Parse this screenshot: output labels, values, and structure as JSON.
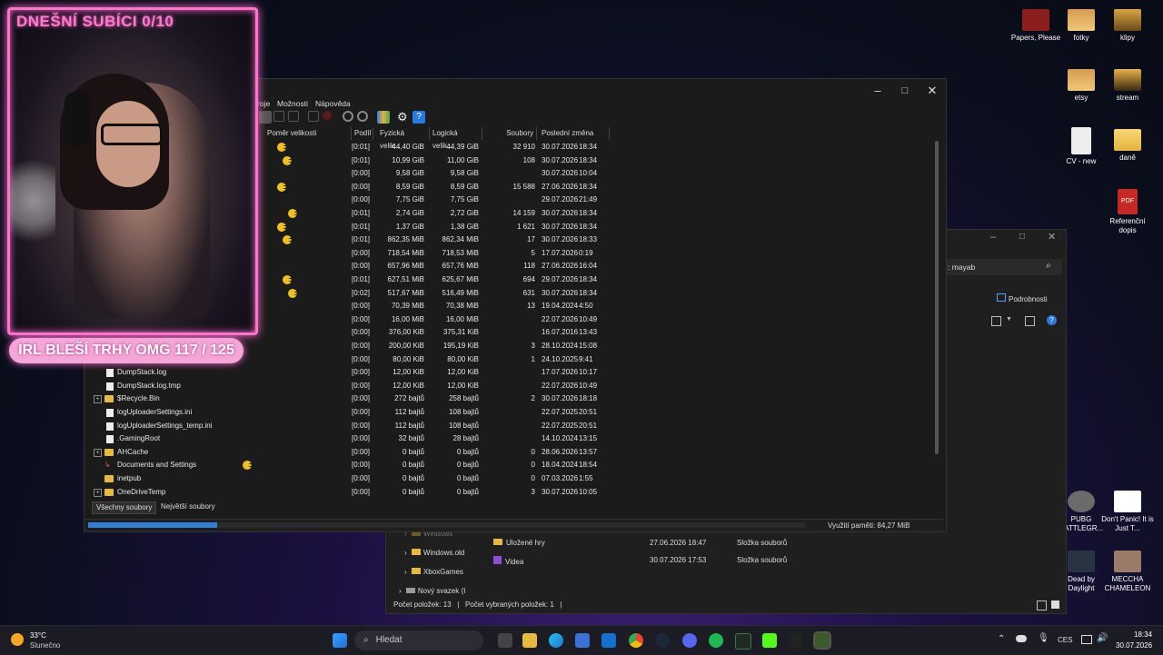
{
  "overlay": {
    "subs_counter": "DNEŠNÍ SUBÍCI 0/10",
    "goal_text": "IRL BLEŠÍ TRHY OMG  117 / 125"
  },
  "desktop": {
    "icons": [
      {
        "label": "Papers, Please",
        "icon": "papers-please-icon"
      },
      {
        "label": "fotky",
        "icon": "folder-icon"
      },
      {
        "label": "klipy",
        "icon": "folder-icon"
      },
      {
        "label": "etsy",
        "icon": "folder-icon"
      },
      {
        "label": "stream",
        "icon": "folder-icon"
      },
      {
        "label": "CV - new",
        "icon": "document-icon"
      },
      {
        "label": "daně",
        "icon": "folder-icon"
      },
      {
        "label": "Referenční dopis",
        "icon": "pdf-icon"
      },
      {
        "label": "PUBG BATTLEGR...",
        "icon": "pubg-icon"
      },
      {
        "label": "Don't Panic! It is Just T...",
        "icon": "dont-panic-icon"
      },
      {
        "label": "Dead by Daylight",
        "icon": "dbd-icon"
      },
      {
        "label": "MECCHA CHAMELEON",
        "icon": "meccha-icon"
      }
    ]
  },
  "main_window": {
    "menu": [
      "roje",
      "Možnosti",
      "Nápověda"
    ],
    "columns": [
      "Poměr velikosti",
      "Podíl",
      "Fyzická velik...",
      "Logická velik...",
      "Soubory",
      "Poslední změna"
    ],
    "rows": [
      {
        "name": "",
        "share": "[0:01]",
        "phys": "44,40 GiB",
        "logic": "44,39 GiB",
        "files": "32 910",
        "date": "30.07.2026",
        "time": "18:34",
        "pac": true
      },
      {
        "name": "",
        "share": "[0:01]",
        "phys": "10,99 GiB",
        "logic": "11,00 GiB",
        "files": "108",
        "date": "30.07.2026",
        "time": "18:34",
        "pac": true
      },
      {
        "name": "",
        "share": "[0:00]",
        "phys": "9,58 GiB",
        "logic": "9,58 GiB",
        "files": "",
        "date": "30.07.2026",
        "time": "10:04",
        "pac": false
      },
      {
        "name": "",
        "share": "[0:00]",
        "phys": "8,59 GiB",
        "logic": "8,59 GiB",
        "files": "15 588",
        "date": "27.06.2026",
        "time": "18:34",
        "pac": true
      },
      {
        "name": "",
        "share": "[0:00]",
        "phys": "7,75 GiB",
        "logic": "7,75 GiB",
        "files": "",
        "date": "29.07.2026",
        "time": "21:49",
        "pac": false
      },
      {
        "name": "",
        "share": "[0:01]",
        "phys": "2,74 GiB",
        "logic": "2,72 GiB",
        "files": "14 159",
        "date": "30.07.2026",
        "time": "18:34",
        "pac": true
      },
      {
        "name": "",
        "share": "[0:01]",
        "phys": "1,37 GiB",
        "logic": "1,38 GiB",
        "files": "1 621",
        "date": "30.07.2026",
        "time": "18:34",
        "pac": true
      },
      {
        "name": "",
        "share": "[0:01]",
        "phys": "862,35 MiB",
        "logic": "862,34 MiB",
        "files": "17",
        "date": "30.07.2026",
        "time": "18:33",
        "pac": true
      },
      {
        "name": "",
        "share": "[0:00]",
        "phys": "718,54 MiB",
        "logic": "718,53 MiB",
        "files": "5",
        "date": "17.07.2026",
        "time": "0:19",
        "pac": false
      },
      {
        "name": "",
        "share": "[0:00]",
        "phys": "657,96 MiB",
        "logic": "657,76 MiB",
        "files": "118",
        "date": "27.06.2026",
        "time": "16:04",
        "pac": false
      },
      {
        "name": "",
        "share": "[0:01]",
        "phys": "627,51 MiB",
        "logic": "625,67 MiB",
        "files": "694",
        "date": "29.07.2026",
        "time": "18:34",
        "pac": true
      },
      {
        "name": "",
        "share": "[0:02]",
        "phys": "517,67 MiB",
        "logic": "516,49 MiB",
        "files": "631",
        "date": "30.07.2026",
        "time": "18:34",
        "pac": true
      },
      {
        "name": "",
        "share": "[0:00]",
        "phys": "70,39 MiB",
        "logic": "70,38 MiB",
        "files": "13",
        "date": "19.04.2024",
        "time": "4:50",
        "pac": false
      },
      {
        "name": "",
        "share": "[0:00]",
        "phys": "16,00 MiB",
        "logic": "16,00 MiB",
        "files": "",
        "date": "22.07.2026",
        "time": "10:49",
        "pac": false
      },
      {
        "name": "",
        "share": "[0:00]",
        "phys": "376,00 KiB",
        "logic": "375,31 KiB",
        "files": "",
        "date": "16.07.2016",
        "time": "13:43",
        "pac": false
      },
      {
        "name": "",
        "share": "[0:00]",
        "phys": "200,00 KiB",
        "logic": "195,19 KiB",
        "files": "3",
        "date": "28.10.2024",
        "time": "15:08",
        "pac": false
      },
      {
        "name": "",
        "share": "[0:00]",
        "phys": "80,00 KiB",
        "logic": "80,00 KiB",
        "files": "1",
        "date": "24.10.2025",
        "time": "9:41",
        "pac": false
      },
      {
        "name": "DumpStack.log",
        "share": "[0:00]",
        "phys": "12,00 KiB",
        "logic": "12,00 KiB",
        "files": "",
        "date": "17.07.2026",
        "time": "10:17",
        "pac": false,
        "kind": "file"
      },
      {
        "name": "DumpStack.log.tmp",
        "share": "[0:00]",
        "phys": "12,00 KiB",
        "logic": "12,00 KiB",
        "files": "",
        "date": "22.07.2026",
        "time": "10:49",
        "pac": false,
        "kind": "file"
      },
      {
        "name": "$Recycle.Bin",
        "share": "[0:00]",
        "phys": "272 bajtů",
        "logic": "258 bajtů",
        "files": "2",
        "date": "30.07.2026",
        "time": "18:18",
        "pac": false,
        "kind": "folder",
        "expand": true
      },
      {
        "name": "logUploaderSettings.ini",
        "share": "[0:00]",
        "phys": "112 bajtů",
        "logic": "108 bajtů",
        "files": "",
        "date": "22.07.2025",
        "time": "20:51",
        "pac": false,
        "kind": "file"
      },
      {
        "name": "logUploaderSettings_temp.ini",
        "share": "[0:00]",
        "phys": "112 bajtů",
        "logic": "108 bajtů",
        "files": "",
        "date": "22.07.2025",
        "time": "20:51",
        "pac": false,
        "kind": "file"
      },
      {
        "name": ".GamingRoot",
        "share": "[0:00]",
        "phys": "32 bajtů",
        "logic": "28 bajtů",
        "files": "",
        "date": "14.10.2024",
        "time": "13:15",
        "pac": false,
        "kind": "file"
      },
      {
        "name": "AHCache",
        "share": "[0:00]",
        "phys": "0 bajtů",
        "logic": "0 bajtů",
        "files": "0",
        "date": "28.06.2026",
        "time": "13:57",
        "pac": false,
        "kind": "folder",
        "expand": true
      },
      {
        "name": "Documents and Settings",
        "share": "[0:00]",
        "phys": "0 bajtů",
        "logic": "0 bajtů",
        "files": "0",
        "date": "18.04.2024",
        "time": "18:54",
        "pac": true,
        "kind": "link"
      },
      {
        "name": "inetpub",
        "share": "[0:00]",
        "phys": "0 bajtů",
        "logic": "0 bajtů",
        "files": "0",
        "date": "07.03.2026",
        "time": "1:55",
        "pac": false,
        "kind": "folder"
      },
      {
        "name": "OneDriveTemp",
        "share": "[0:00]",
        "phys": "0 bajtů",
        "logic": "0 bajtů",
        "files": "3",
        "date": "30.07.2026",
        "time": "10:05",
        "pac": false,
        "kind": "folder",
        "expand": true
      }
    ],
    "tabs": [
      "Všechny soubory",
      "Největší soubory"
    ],
    "memory_usage": "Využití paměti: 84,27 MiB",
    "progress": 0.18
  },
  "explorer": {
    "search_text": ": mayab",
    "details_label": "Podrobnosti",
    "tree": [
      "Windows",
      "Windows.old",
      "XboxGames",
      "Nový svazek (I"
    ],
    "files": [
      {
        "name": "Uložené hry",
        "date": "27.06.2026 18:47",
        "type": "Složka souborů"
      },
      {
        "name": "Videa",
        "date": "30.07.2026 17:53",
        "type": "Složka souborů"
      }
    ],
    "status_count": "Počet položek: 13",
    "status_selected": "Počet vybraných položek: 1"
  },
  "taskbar": {
    "weather_temp": "33°C",
    "weather_desc": "Slunečno",
    "search_placeholder": "Hledat",
    "language": "CES",
    "time": "18:34",
    "date": "30.07.2026"
  }
}
